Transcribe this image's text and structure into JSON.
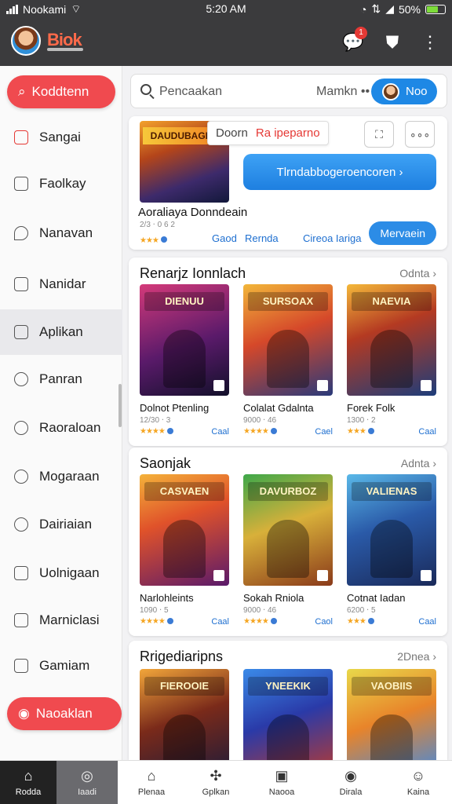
{
  "status": {
    "carrier": "Nookami",
    "time": "5:20 AM",
    "battery": "50%"
  },
  "header": {
    "brand": "Biok",
    "notification_count": "1"
  },
  "sidebar": {
    "top_button": "Koddtenn",
    "items": [
      {
        "label": "Sangai"
      },
      {
        "label": "Faolkay"
      },
      {
        "label": "Nanavan"
      },
      {
        "label": "Nanidar"
      },
      {
        "label": "Aplikan"
      },
      {
        "label": "Panran"
      },
      {
        "label": "Raoraloan"
      },
      {
        "label": "Mogaraan"
      },
      {
        "label": "Dairiaian"
      },
      {
        "label": "Uolnigaan"
      },
      {
        "label": "Marniclasi"
      },
      {
        "label": "Gamiam"
      }
    ],
    "bottom_button": "Naoaklan"
  },
  "search": {
    "placeholder": "Pencaakan",
    "mode": "Mamkn ••",
    "button": "Noo"
  },
  "featured": {
    "art_title": "DAUDUBAGER",
    "tag_left": "Doorn",
    "tag_right": "Ra ipeparno",
    "icon_a": "⛶",
    "icon_b": "∘∘∘",
    "main_button": "Tlrndabbogeroencoren ›",
    "title": "Aoraliaya Donndeain",
    "meta": "2/3 ‧ 0 6 2",
    "link1": "Gaod",
    "link2": "Rernda",
    "link3": "Cireoa Iariga",
    "action": "Mervaein"
  },
  "sections": [
    {
      "title": "Renarjz Ionnlach",
      "more": "Odnta ›",
      "games": [
        {
          "art": "DIENUU",
          "name": "Dolnot Ptenling",
          "meta": "12/30 ‧ 3",
          "get": "Caal"
        },
        {
          "art": "SURSOAX",
          "name": "Colalat Gdalnta",
          "meta": "9000 ‧ 46",
          "get": "Cael"
        },
        {
          "art": "NAEVIA",
          "name": "Forek Folk",
          "meta": "1300 ‧ 2",
          "get": "Caal"
        }
      ]
    },
    {
      "title": "Saonjak",
      "more": "Adnta ›",
      "games": [
        {
          "art": "CASVAEN",
          "name": "Narlohleints",
          "meta": "1090 ‧ 5",
          "get": "Caal"
        },
        {
          "art": "DAVURBOZ",
          "name": "Sokah Rniola",
          "meta": "9000 ‧ 46",
          "get": "Caol"
        },
        {
          "art": "VALIENAS",
          "name": "Cotnat Iadan",
          "meta": "6200 ‧ 5",
          "get": "Caal"
        }
      ]
    },
    {
      "title": "Rrigediaripns",
      "more": "2Dnea ›",
      "games": [
        {
          "art": "FIEROOIE",
          "name": "",
          "meta": "",
          "get": ""
        },
        {
          "art": "YNEEKIK",
          "name": "",
          "meta": "",
          "get": ""
        },
        {
          "art": "VAOBIIS",
          "name": "",
          "meta": "",
          "get": ""
        }
      ]
    }
  ],
  "bottom_nav": [
    {
      "label": "Rodda"
    },
    {
      "label": "Iaadi"
    },
    {
      "label": "Plenaa"
    },
    {
      "label": "Gplkan"
    },
    {
      "label": "Naooa"
    },
    {
      "label": "Dirala"
    },
    {
      "label": "Kaina"
    }
  ],
  "colors": {
    "accent_red": "#f04a4f",
    "accent_blue": "#1e88e5",
    "header_bg": "#3b3b3d"
  }
}
